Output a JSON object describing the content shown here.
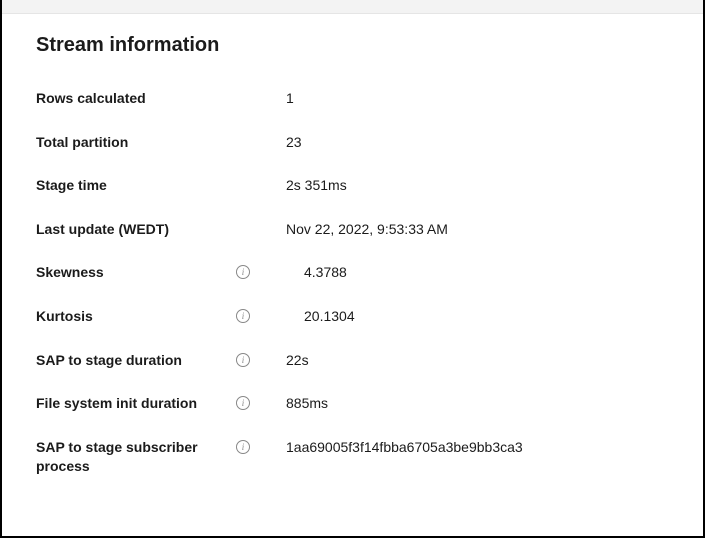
{
  "panel": {
    "title": "Stream information",
    "rows": {
      "rowsCalculated": {
        "label": "Rows calculated",
        "value": "1"
      },
      "totalPartition": {
        "label": "Total partition",
        "value": "23"
      },
      "stageTime": {
        "label": "Stage time",
        "value": "2s 351ms"
      },
      "lastUpdate": {
        "label": "Last update (WEDT)",
        "value": "Nov 22, 2022, 9:53:33 AM"
      },
      "skewness": {
        "label": "Skewness",
        "value": "4.3788"
      },
      "kurtosis": {
        "label": "Kurtosis",
        "value": "20.1304"
      },
      "sapToStageDuration": {
        "label": "SAP to stage duration",
        "value": "22s"
      },
      "fileSystemInitDuration": {
        "label": "File system init duration",
        "value": "885ms"
      },
      "sapToStageSubscriber": {
        "label": "SAP to stage subscriber process",
        "value": "1aa69005f3f14fbba6705a3be9bb3ca3"
      }
    }
  }
}
